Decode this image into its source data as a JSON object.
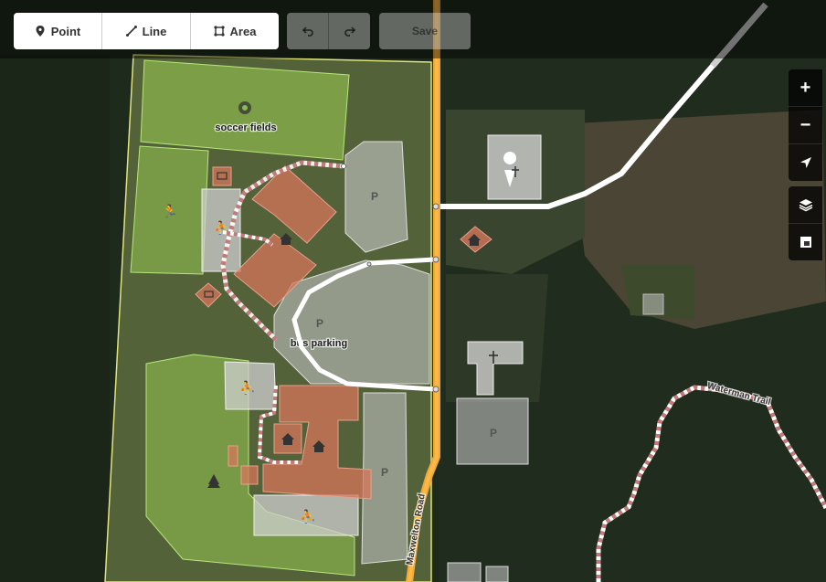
{
  "toolbar": {
    "point_label": "Point",
    "line_label": "Line",
    "area_label": "Area",
    "save_label": "Save"
  },
  "map_controls": {
    "zoom_in": "+",
    "zoom_out": "−"
  },
  "labels": {
    "soccer_fields": "soccer fields",
    "bus_parking": "bus parking",
    "road": "Maxwelton Road",
    "trail": "Waterman Trail",
    "parking_symbol": "P"
  },
  "colors": {
    "area_green": "#8bc34a",
    "building_red": "#d4755a",
    "road_orange": "#f0a83a",
    "path_dashed": "#c47a7a"
  }
}
